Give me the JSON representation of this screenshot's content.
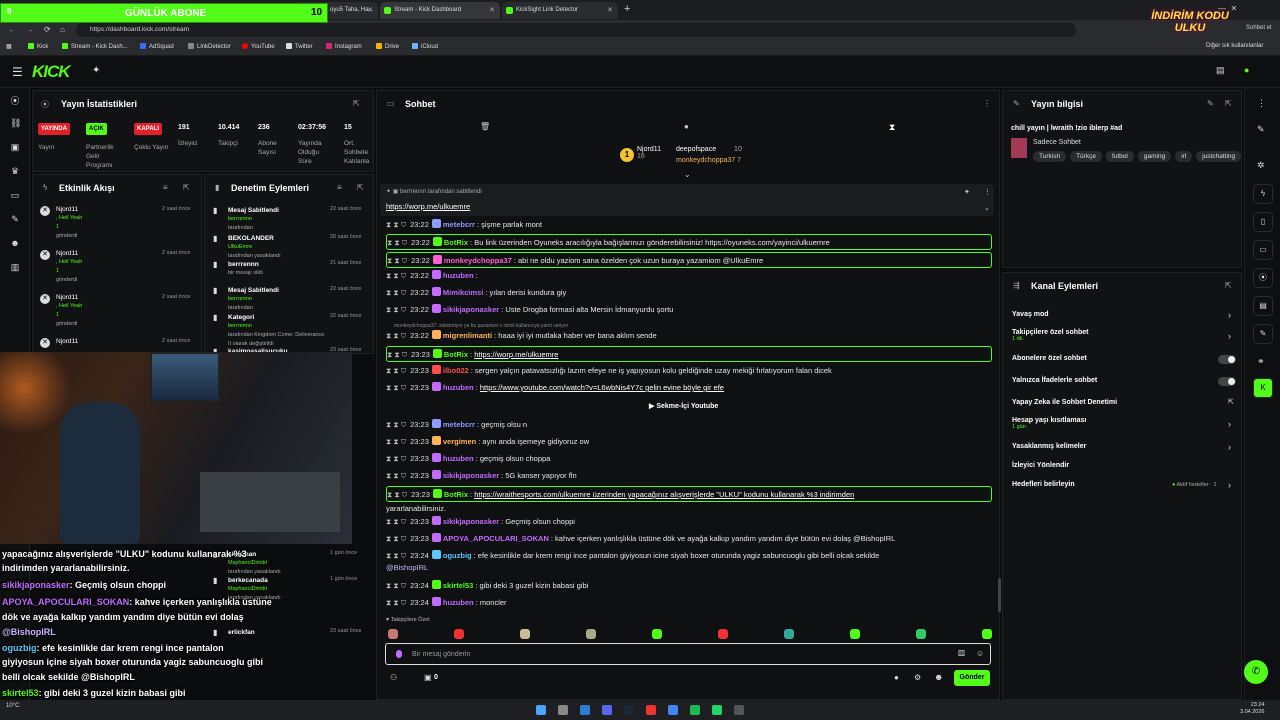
{
  "browser": {
    "tabs": [
      "Stream - Kick Dashboard",
      "KickSight Link Detector",
      "lyDrama oyu5 Taha, Ha..."
    ],
    "url": "https://dashboard.kick.com/stream",
    "bookmarks": [
      "Kick",
      "Stream - Kick Dash...",
      "AdSquad",
      "LinkDetector",
      "YouTube",
      "Twitter",
      "Instagram",
      "Drive",
      "iCloud"
    ],
    "other_bookmarks": "Diğer sık kullanılanlar",
    "sohbet": "Sohbet et"
  },
  "overlay": {
    "sub_goal_label": "GÜNLÜK ABONE",
    "sub_goal_current": "9",
    "sub_goal_target": "10",
    "promo": "İNDİRİM KODU ULKU"
  },
  "stats": {
    "title": "Yayın İstatistikleri",
    "badges": [
      {
        "text": "YAYINDA",
        "label": "Yayın",
        "color": "#e0202a"
      },
      {
        "text": "AÇIK",
        "label": "Partnerlik Gelir Programı",
        "color": "#53fc18"
      },
      {
        "text": "KAPALI",
        "label": "Çoklu Yayın",
        "color": "#e0202a"
      }
    ],
    "numbers": [
      {
        "v": "191",
        "l": "İzleyici"
      },
      {
        "v": "10.414",
        "l": "Takipçi"
      },
      {
        "v": "236",
        "l": "Abone Sayısı"
      },
      {
        "v": "02:37:56",
        "l": "Yayında Olduğu Süre"
      },
      {
        "v": "15",
        "l": "Ort. Sohbete Katılanla"
      }
    ]
  },
  "activity": {
    "title": "Etkinlik Akışı",
    "items": [
      {
        "user": "Njord11",
        "msg": ", Heil Yeah",
        "amt": "1",
        "sub": "gönderdi",
        "time": "2 saat önce"
      },
      {
        "user": "Njord11",
        "msg": ", Heil Yeah",
        "amt": "1",
        "sub": "gönderdi",
        "time": "2 saat önce"
      },
      {
        "user": "Njord11",
        "msg": ", Heil Yeah",
        "amt": "1",
        "sub": "gönderdi",
        "time": "2 saat önce"
      },
      {
        "user": "Njord11",
        "msg": "",
        "amt": "",
        "sub": "",
        "time": "2 saat önce"
      }
    ]
  },
  "moderation": {
    "title": "Denetim Eylemleri",
    "items": [
      {
        "action": "Mesaj Sabitlendi",
        "by": "berrrennn",
        "sub": "tarafından",
        "time": "22 saat önce"
      },
      {
        "action": "BEKOLANDER",
        "by": "UlkuEmre",
        "sub": "tarafından yasaklandı",
        "time": "20 saat önce"
      },
      {
        "action": "berrrennn",
        "by": "",
        "sub": "bir mesajı sildi",
        "time": "21 saat önce"
      },
      {
        "action": "Mesaj Sabitlendi",
        "by": "berrrennn",
        "sub": "tarafından",
        "time": "22 saat önce"
      },
      {
        "action": "Kategori",
        "by": "berrrennn",
        "sub": "tarafından Kingdom Come: Deliverance II olarak değiştirildi",
        "time": "22 saat önce"
      },
      {
        "action": "kasimoasalisucuku",
        "by": "",
        "sub": "",
        "time": "23 saat önce"
      },
      {
        "action": "akosman",
        "by": "MayhanciDimitri",
        "sub": "tarafından yasaklandı",
        "time": "1 gün önce"
      },
      {
        "action": "berkecanada",
        "by": "MayhanciDimitri",
        "sub": "tarafından yasaklandı",
        "time": "1 gün önce"
      },
      {
        "action": "erlickfan",
        "by": "",
        "sub": "",
        "time": "23 saat önce"
      }
    ]
  },
  "overlay_chat": [
    {
      "u": "",
      "t": "yapacağınız alışverişlerde \"ULKU\" kodunu kullanarak %3",
      "c": "#ffffff"
    },
    {
      "u": "",
      "t": "indirimden yararlanabilirsiniz.",
      "c": "#ffffff"
    },
    {
      "u": "sikikjaponasker",
      "t": ": Geçmiş olsun choppi",
      "c": "#c36bff"
    },
    {
      "u": "APOYA_APOCULARI_SOKAN",
      "t": ": kahve içerken yanlışlıkla üstüne",
      "c": "#c36bff"
    },
    {
      "u": "",
      "t": "dök ve ayağa kalkıp yandım yandım diye bütün evi dolaş",
      "c": "#ffffff"
    },
    {
      "u": "@BishopIRL",
      "t": "",
      "c": "#c7b8ff"
    },
    {
      "u": "oguzbig",
      "t": ": efe kesinlikle dar krem rengi ince pantalon",
      "c": "#5ac8fa"
    },
    {
      "u": "",
      "t": "giyiyosun içine siyah boxer oturunda yagiz sabuncuoglu gibi",
      "c": "#ffffff"
    },
    {
      "u": "",
      "t": "belli olcak sekilde @BishopIRL",
      "c": "#ffffff"
    },
    {
      "u": "skirtel53",
      "t": ": gibi deki 3 guzel kizin babasi gibi",
      "c": "#53fc18"
    },
    {
      "u": "huzuben",
      "t": ": moncler",
      "c": "#ffffff"
    }
  ],
  "chat": {
    "title": "Sohbet",
    "top_gifters": [
      {
        "u": "Njord11",
        "v": "16"
      },
      {
        "u": "deepofspace",
        "v": "10"
      },
      {
        "u": "monkeydchoppa37",
        "v": "7"
      }
    ],
    "pinned_by": "berrrennn tarafından sabitlendi",
    "pinned_link": "https://worp.me/ulkuemre",
    "messages": [
      {
        "time": "23:22",
        "user": "metebcrr",
        "ucolor": "#8f9bff",
        "text": "şişme parlak mont",
        "hl": false
      },
      {
        "time": "23:22",
        "user": "BotRix",
        "ucolor": "#53fc18",
        "text": "Bu link üzerinden Oyuneks aracılığıyla bağışlarınızı gönderebilirsiniz! https://oyuneks.com/yayinci/ulkuemre",
        "hl": true
      },
      {
        "time": "23:22",
        "user": "monkeydchoppa37",
        "ucolor": "#ff5fd2",
        "text": "abi ne oldu yaziom sana özelden çok uzun buraya yazamiom @UlkuEmre",
        "hl": true
      },
      {
        "time": "23:22",
        "user": "huzuben",
        "ucolor": "#c36bff",
        "text": "",
        "hl": false
      },
      {
        "time": "23:22",
        "user": "Mimikcimsi",
        "ucolor": "#c36bff",
        "text": "yılan derisi kundura giy",
        "hl": false
      },
      {
        "time": "23:22",
        "user": "sikikjaponasker",
        "ucolor": "#c36bff",
        "text": "Uste Drogba formasi alta Mersin İdmanyurdu şortu",
        "hl": false
      },
      {
        "time": "23:22",
        "user": "migrenlimanti",
        "ucolor": "#ffb35a",
        "text": "haaa iyi iyi mutlaka haber ver bana aklım sende",
        "hl": false
      },
      {
        "time": "23:23",
        "user": "BotRix",
        "ucolor": "#53fc18",
        "text": "https://worp.me/ulkuemre",
        "hl": true
      },
      {
        "time": "23:23",
        "user": "ilbo022",
        "ucolor": "#ff4d4d",
        "text": "sergen yalçın patavatsızlığı lazım efeye ne iş yapıyosun kolu geldiğinde uzay mekiği fırlatıyorum falan dicek",
        "hl": false
      },
      {
        "time": "23:23",
        "user": "huzuben",
        "ucolor": "#c36bff",
        "text": "https://www.youtube.com/watch?v=L6wbNis4Y7c gelin evine böyle gir efe",
        "hl": false
      },
      {
        "time": "23:23",
        "user": "metebcrr",
        "ucolor": "#8f9bff",
        "text": "geçmiş olsu n",
        "hl": false
      },
      {
        "time": "23:23",
        "user": "vergimen",
        "ucolor": "#ffb35a",
        "text": "aynı anda işemeye gidiyoruz ow",
        "hl": false
      },
      {
        "time": "23:23",
        "user": "huzuben",
        "ucolor": "#c36bff",
        "text": "geçmiş olsun choppa",
        "hl": false
      },
      {
        "time": "23:23",
        "user": "sikikjaponasker",
        "ucolor": "#c36bff",
        "text": "5G kanser yapıyor fln",
        "hl": false
      },
      {
        "time": "23:23",
        "user": "BotRix",
        "ucolor": "#53fc18",
        "text": "https://wraithesports.com/ulkuemre üzerinden yapacağınız alışverişlerde \"ULKU\" kodunu kullanarak %3 indirimden",
        "hl": true
      },
      {
        "time": "23:23",
        "user": "sikikjaponasker",
        "ucolor": "#c36bff",
        "text": "Geçmiş olsun choppi",
        "hl": false
      },
      {
        "time": "23:23",
        "user": "APOYA_APOCULARI_SOKAN",
        "ucolor": "#c36bff",
        "text": "kahve içerken yanlışlıkla üstüne dök ve ayağa kalkıp yandım yandım diye bütün evi dolaş @BishopIRL",
        "hl": false
      },
      {
        "time": "23:24",
        "user": "oguzbig",
        "ucolor": "#5ac8fa",
        "text": "efe kesinlikle dar krem rengi ince pantalon giyiyosun icine siyah boxer oturunda yagiz sabuncuoglu gibi belli olcak sekilde",
        "hl": false
      },
      {
        "time": "23:24",
        "user": "skirtel53",
        "ucolor": "#53fc18",
        "text": "gibi deki 3 guzel kizin babasi gibi",
        "hl": false
      },
      {
        "time": "23:24",
        "user": "huzuben",
        "ucolor": "#c36bff",
        "text": "moncler",
        "hl": false
      }
    ],
    "botrix_cont": "yararlanabilirsiniz.",
    "oguz_cont": "@BishopIRL",
    "deleted_note": "monkeydchoppa37: zakismiyor ya bu pazartesi o isimli kullanıcıya yanıt veriyor",
    "youtube_embed": "Sekme-İçi Youtube",
    "followers_only": "Takipçilere Özel",
    "input_placeholder": "Bir mesaj gönderin",
    "send_label": "Gönder",
    "points": "0"
  },
  "stream_info": {
    "title": "Yayın bilgisi",
    "stream_title": "chill yayın | lwraith !zio iblerp #ad",
    "category": "Sadece Sohbet",
    "tags": [
      "Turkish",
      "Türkçe",
      "futbol",
      "gaming",
      "irl",
      "justchatting"
    ]
  },
  "channel_actions": {
    "title": "Kanal Eylemleri",
    "items": [
      {
        "label": "Yavaş mod",
        "sub": "",
        "kind": "chev"
      },
      {
        "label": "Takipçilere özel sohbet",
        "sub": "1 dk.",
        "kind": "chev"
      },
      {
        "label": "Abonelere özel sohbet",
        "sub": "",
        "kind": "toggle"
      },
      {
        "label": "Yalnızca İfadelerle sohbet",
        "sub": "",
        "kind": "toggle"
      },
      {
        "label": "Yapay Zeka ile Sohbet Denetimi",
        "sub": "",
        "kind": "ext"
      },
      {
        "label": "Hesap yaşı kısıtlaması",
        "sub": "1 gün",
        "kind": "chev"
      },
      {
        "label": "Yasaklanmış kelimeler",
        "sub": "",
        "kind": "chev"
      },
      {
        "label": "İzleyici Yönlendir",
        "sub": "",
        "kind": "none"
      },
      {
        "label": "Hedefleri belirleyin",
        "sub": "",
        "kind": "goal"
      }
    ],
    "goal_status": "Aktif hedefler · 1"
  },
  "taskbar": {
    "weather": "10°C",
    "time": "23:24",
    "date": "3.04.2026"
  }
}
